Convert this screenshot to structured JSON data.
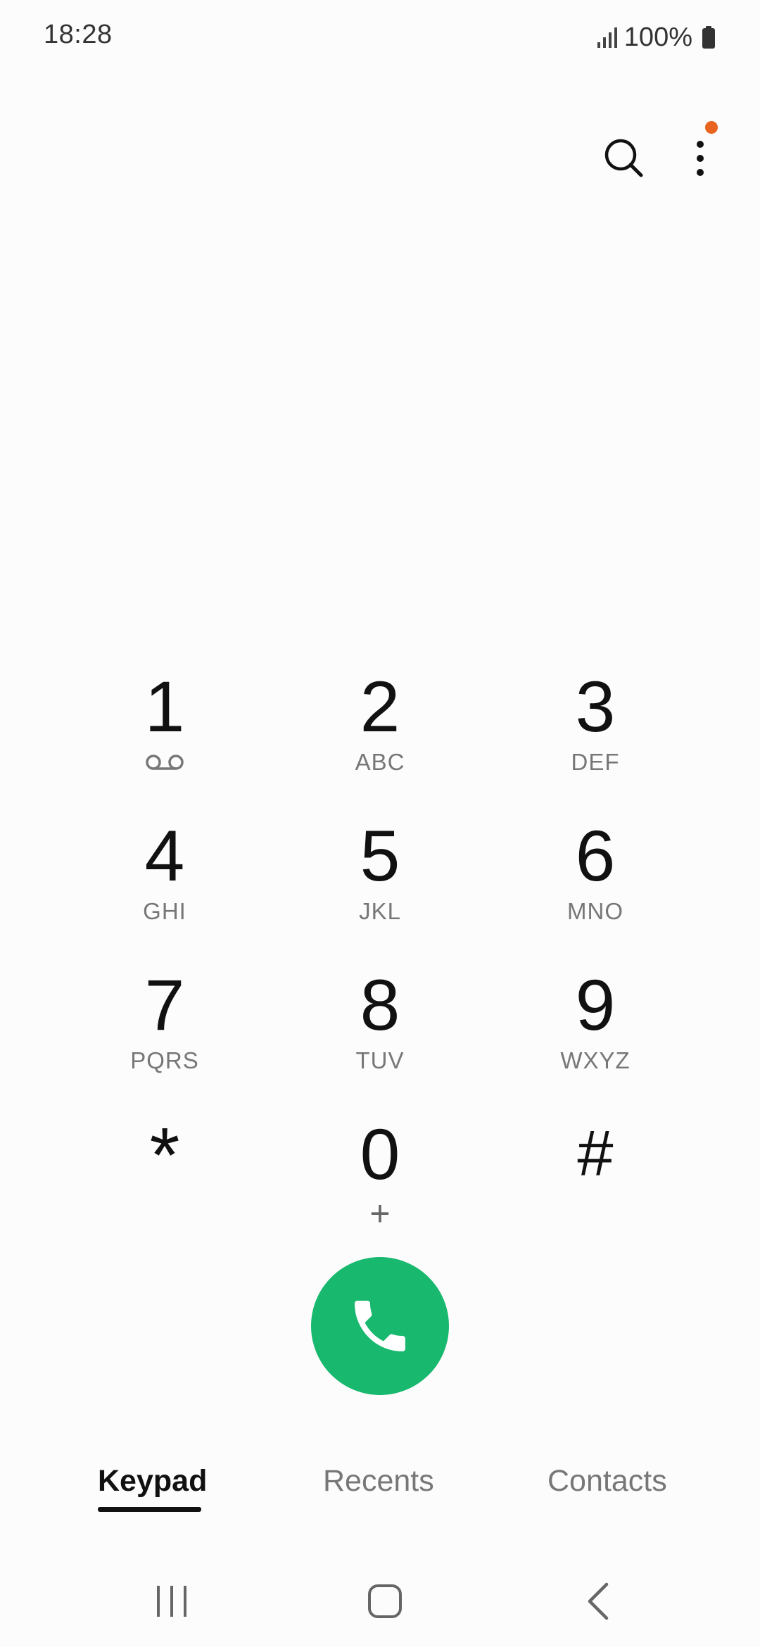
{
  "status_bar": {
    "time": "18:28",
    "battery": "100%"
  },
  "header": {
    "icons": [
      "search-icon",
      "more-options-icon"
    ],
    "notification_dot_color": "#e8641f"
  },
  "keypad": {
    "keys": [
      {
        "digit": "1",
        "sub": "",
        "icon": "voicemail-icon"
      },
      {
        "digit": "2",
        "sub": "ABC"
      },
      {
        "digit": "3",
        "sub": "DEF"
      },
      {
        "digit": "4",
        "sub": "GHI"
      },
      {
        "digit": "5",
        "sub": "JKL"
      },
      {
        "digit": "6",
        "sub": "MNO"
      },
      {
        "digit": "7",
        "sub": "PQRS"
      },
      {
        "digit": "8",
        "sub": "TUV"
      },
      {
        "digit": "9",
        "sub": "WXYZ"
      },
      {
        "digit": "*",
        "sub": ""
      },
      {
        "digit": "0",
        "sub": "+"
      },
      {
        "digit": "#",
        "sub": ""
      }
    ]
  },
  "call_button": {
    "icon": "phone-icon",
    "color": "#18b86e"
  },
  "tabs": [
    {
      "label": "Keypad",
      "active": true
    },
    {
      "label": "Recents",
      "active": false
    },
    {
      "label": "Contacts",
      "active": false
    }
  ],
  "nav_bar": {
    "icons": [
      "recent-apps-icon",
      "home-icon",
      "back-icon"
    ]
  }
}
